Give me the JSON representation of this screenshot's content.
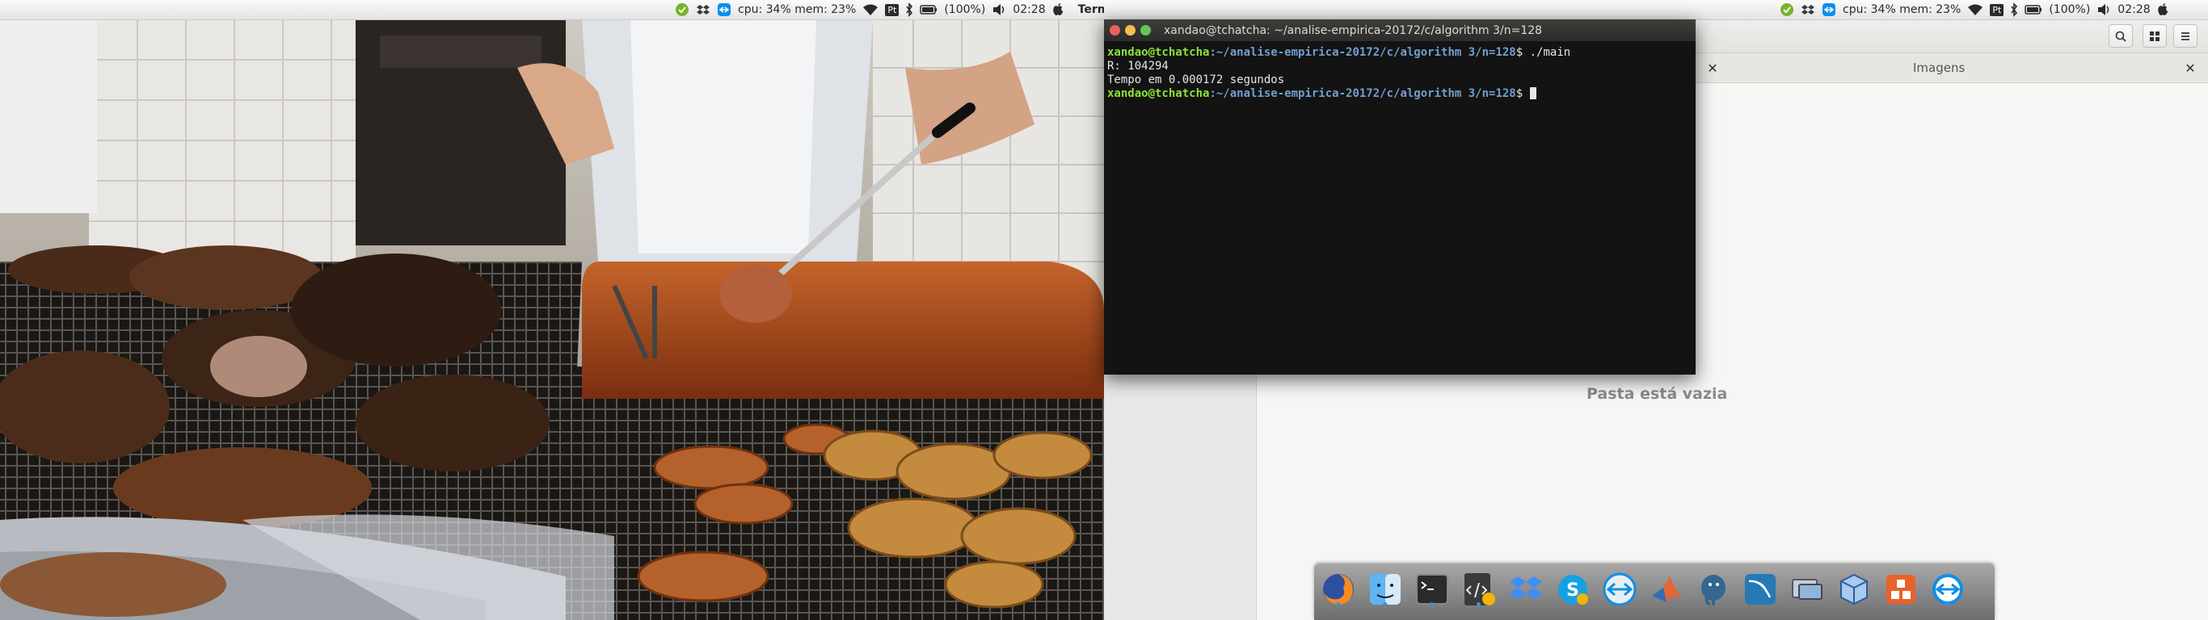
{
  "top_bar": {
    "cpu_mem": "cpu: 34% mem: 23%",
    "keyboard_layout": "Pt",
    "battery": "(100%)",
    "time": "02:28",
    "active_app": "Terminal"
  },
  "terminal": {
    "title": "xandao@tchatcha: ~/analise-empirica-20172/c/algorithm 3/n=128",
    "prompt_user": "xandao@tchatcha",
    "prompt_path": ":~/analise-empirica-20172/c/algorithm 3/n=128",
    "prompt_suffix": "$",
    "command": " ./main",
    "output": [
      "R: 104294",
      "Tempo em 0.000172 segundos"
    ]
  },
  "file_manager": {
    "tab_label": "Imagens",
    "empty_label": "Pasta está vazia"
  },
  "dock": {
    "items": [
      "firefox-icon",
      "finder-icon",
      "terminal-icon",
      "code-editor-icon",
      "dropbox-icon",
      "skype-icon",
      "teamviewer-icon",
      "matlab-icon",
      "postgresql-icon",
      "mysql-workbench-icon",
      "remote-desktop-icon",
      "virtualbox-icon",
      "ubuntu-software-icon",
      "teamviewer-icon"
    ],
    "running": [
      0,
      1,
      2,
      3,
      5,
      13
    ]
  },
  "colors": {
    "accent_green": "#8ae234",
    "accent_blue": "#729fcf",
    "close": "#ed5f5d",
    "minimize": "#f4bf4f",
    "maximize": "#62c655"
  }
}
